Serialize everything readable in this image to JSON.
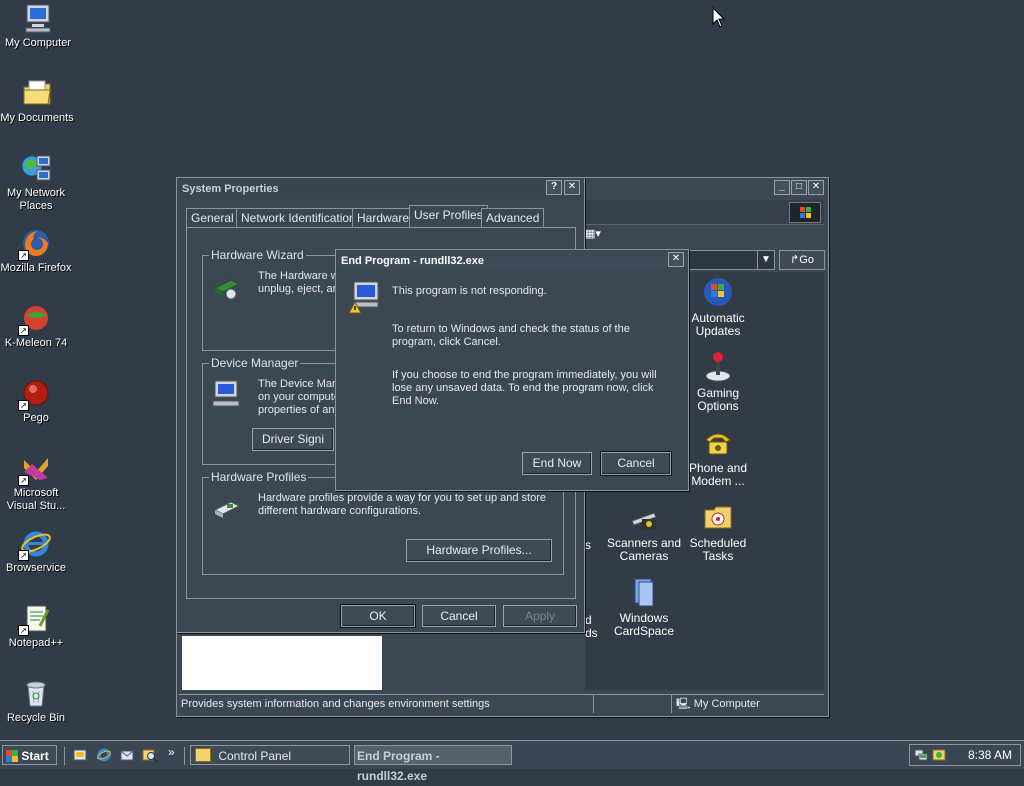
{
  "desktop": {
    "icons": [
      {
        "label": "My Computer",
        "icon": "computer-icon"
      },
      {
        "label": "My Documents",
        "icon": "folder-icon"
      },
      {
        "label": "My Network Places",
        "icon": "network-icon"
      },
      {
        "label": "Mozilla Firefox",
        "icon": "firefox-icon"
      },
      {
        "label": "K-Meleon 74",
        "icon": "kmeleon-icon"
      },
      {
        "label": "Pego",
        "icon": "pego-icon"
      },
      {
        "label": "Microsoft Visual Stu...",
        "icon": "visual-studio-icon"
      },
      {
        "label": "Browservice",
        "icon": "ie-icon"
      },
      {
        "label": "Notepad++",
        "icon": "notepad-icon"
      },
      {
        "label": "Recycle Bin",
        "icon": "recycle-bin-icon"
      }
    ]
  },
  "control_panel": {
    "go_label": "Go",
    "icons": [
      {
        "label": "Automatic Updates",
        "icon": "windows-update-icon"
      },
      {
        "label": "Gaming Options",
        "icon": "joystick-icon"
      },
      {
        "label": "Phone and Modem ...",
        "icon": "phone-icon"
      },
      {
        "label": "Scanners and Cameras",
        "icon": "scanner-icon"
      },
      {
        "label": "Scheduled Tasks",
        "icon": "scheduled-tasks-icon"
      },
      {
        "label": "Windows CardSpace",
        "icon": "cardspace-icon"
      }
    ],
    "partial_labels": [
      "d",
      "ds",
      "s"
    ],
    "status_left": "Provides system information and changes environment settings",
    "status_right": "My Computer"
  },
  "system_properties": {
    "title": "System Properties",
    "tabs": [
      "General",
      "Network Identification",
      "Hardware",
      "User Profiles",
      "Advanced"
    ],
    "active_tab": "User Profiles",
    "hardware_wizard": {
      "title": "Hardware Wizard",
      "text": "The Hardware w unplug, eject, an"
    },
    "device_manager": {
      "title": "Device Manager",
      "text": "The Device Mar on your compute properties of any",
      "button": "Driver Signi"
    },
    "hardware_profiles": {
      "title": "Hardware Profiles",
      "text": "Hardware profiles provide a way for you to set up and store different hardware configurations.",
      "button": "Hardware Profiles..."
    },
    "ok": "OK",
    "cancel": "Cancel",
    "apply": "Apply"
  },
  "end_program": {
    "title": "End Program - rundll32.exe",
    "line1": "This program is not responding.",
    "line2": "To return to Windows and check the status of the program, click Cancel.",
    "line3": "If you choose to end the program immediately, you will lose any unsaved data. To end the program now, click End Now.",
    "end_now": "End Now",
    "cancel": "Cancel"
  },
  "taskbar": {
    "start": "Start",
    "overflow": "»",
    "tasks": [
      {
        "label": "Control Panel",
        "active": false
      },
      {
        "label": "End Program - rundll32.exe",
        "active": true
      }
    ],
    "clock": "8:38 AM"
  },
  "colors": {
    "desktop": "#323c48",
    "window": "#3c4754",
    "border": "#8a94a0"
  }
}
